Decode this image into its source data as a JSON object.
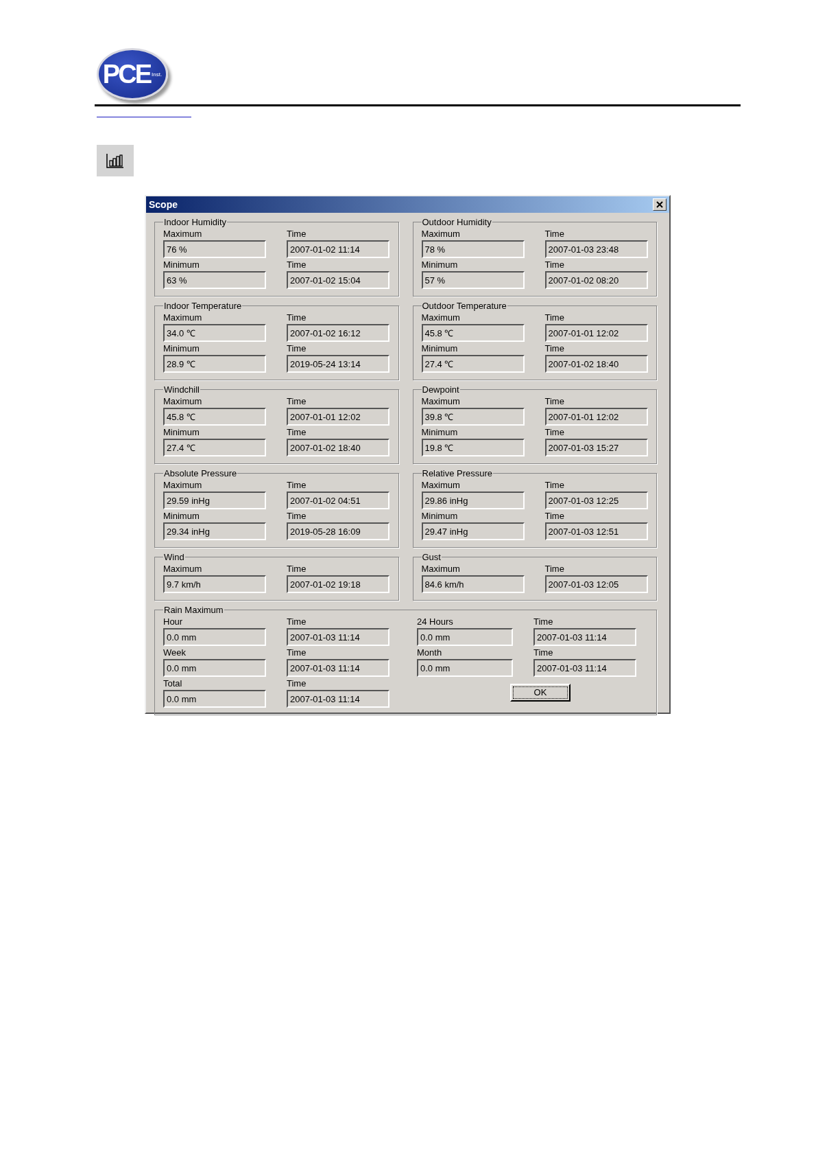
{
  "logo": {
    "letters": "PCE",
    "sub": "Inst."
  },
  "dialog": {
    "title": "Scope",
    "panels": [
      {
        "kind": "half",
        "title": "Indoor Humidity",
        "fields": [
          {
            "label": "Maximum",
            "value": "76 %"
          },
          {
            "label": "Time",
            "value": "2007-01-02 11:14"
          },
          {
            "label": "Minimum",
            "value": "63 %"
          },
          {
            "label": "Time",
            "value": "2007-01-02 15:04"
          }
        ]
      },
      {
        "kind": "half",
        "title": "Outdoor Humidity",
        "fields": [
          {
            "label": "Maximum",
            "value": "78 %"
          },
          {
            "label": "Time",
            "value": "2007-01-03 23:48"
          },
          {
            "label": "Minimum",
            "value": "57 %"
          },
          {
            "label": "Time",
            "value": "2007-01-02 08:20"
          }
        ]
      },
      {
        "kind": "half",
        "title": "Indoor Temperature",
        "fields": [
          {
            "label": "Maximum",
            "value": "34.0 ℃"
          },
          {
            "label": "Time",
            "value": "2007-01-02 16:12"
          },
          {
            "label": "Minimum",
            "value": "28.9 ℃"
          },
          {
            "label": "Time",
            "value": "2019-05-24 13:14"
          }
        ]
      },
      {
        "kind": "half",
        "title": "Outdoor Temperature",
        "fields": [
          {
            "label": "Maximum",
            "value": "45.8 ℃"
          },
          {
            "label": "Time",
            "value": "2007-01-01 12:02"
          },
          {
            "label": "Minimum",
            "value": "27.4 ℃"
          },
          {
            "label": "Time",
            "value": "2007-01-02 18:40"
          }
        ]
      },
      {
        "kind": "half",
        "title": "Windchill",
        "fields": [
          {
            "label": "Maximum",
            "value": "45.8 ℃"
          },
          {
            "label": "Time",
            "value": "2007-01-01 12:02"
          },
          {
            "label": "Minimum",
            "value": "27.4 ℃"
          },
          {
            "label": "Time",
            "value": "2007-01-02 18:40"
          }
        ]
      },
      {
        "kind": "half",
        "title": "Dewpoint",
        "fields": [
          {
            "label": "Maximum",
            "value": "39.8 ℃"
          },
          {
            "label": "Time",
            "value": "2007-01-01 12:02"
          },
          {
            "label": "Minimum",
            "value": "19.8 ℃"
          },
          {
            "label": "Time",
            "value": "2007-01-03 15:27"
          }
        ]
      },
      {
        "kind": "half",
        "title": "Absolute Pressure",
        "fields": [
          {
            "label": "Maximum",
            "value": "29.59 inHg"
          },
          {
            "label": "Time",
            "value": "2007-01-02 04:51"
          },
          {
            "label": "Minimum",
            "value": "29.34 inHg"
          },
          {
            "label": "Time",
            "value": "2019-05-28 16:09"
          }
        ]
      },
      {
        "kind": "half",
        "title": "Relative Pressure",
        "fields": [
          {
            "label": "Maximum",
            "value": "29.86 inHg"
          },
          {
            "label": "Time",
            "value": "2007-01-03 12:25"
          },
          {
            "label": "Minimum",
            "value": "29.47 inHg"
          },
          {
            "label": "Time",
            "value": "2007-01-03 12:51"
          }
        ]
      },
      {
        "kind": "half",
        "title": "Wind",
        "fields": [
          {
            "label": "Maximum",
            "value": "9.7 km/h"
          },
          {
            "label": "Time",
            "value": "2007-01-02 19:18"
          }
        ]
      },
      {
        "kind": "half",
        "title": "Gust",
        "fields": [
          {
            "label": "Maximum",
            "value": "84.6 km/h"
          },
          {
            "label": "Time",
            "value": "2007-01-03 12:05"
          }
        ]
      },
      {
        "kind": "full",
        "title": "Rain Maximum",
        "fields": [
          {
            "label": "Hour",
            "value": "0.0 mm"
          },
          {
            "label": "Time",
            "value": "2007-01-03 11:14"
          },
          {
            "label": "24 Hours",
            "value": "0.0 mm"
          },
          {
            "label": "Time",
            "value": "2007-01-03 11:14"
          },
          {
            "label": "Week",
            "value": "0.0 mm"
          },
          {
            "label": "Time",
            "value": "2007-01-03 11:14"
          },
          {
            "label": "Month",
            "value": "0.0 mm"
          },
          {
            "label": "Time",
            "value": "2007-01-03 11:14"
          },
          {
            "label": "Total",
            "value": "0.0 mm"
          },
          {
            "label": "Time",
            "value": "2007-01-03 11:14"
          }
        ]
      }
    ],
    "ok_button": "OK"
  }
}
